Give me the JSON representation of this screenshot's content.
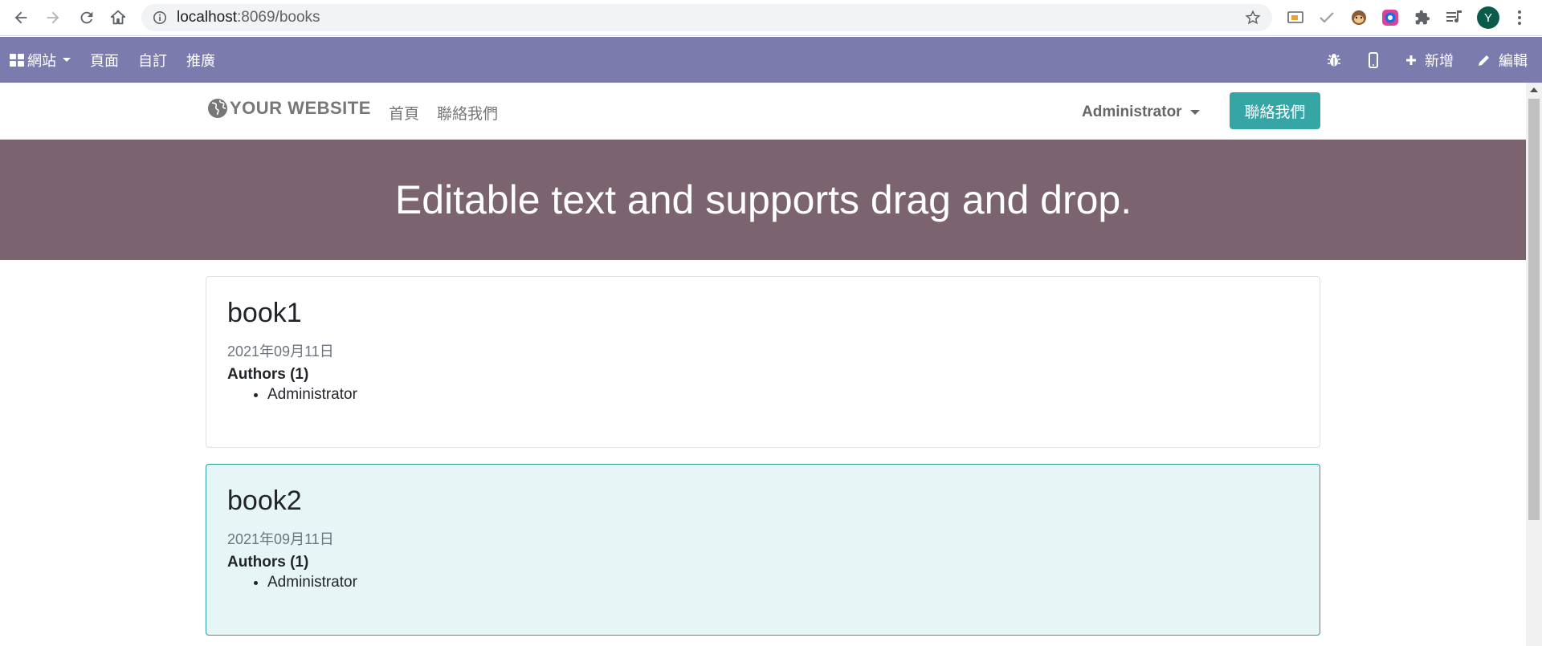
{
  "browser": {
    "url_host": "localhost",
    "url_path": ":8069/books",
    "profile_initial": "Y"
  },
  "adminbar": {
    "apps_label": "網站",
    "pages_label": "頁面",
    "customize_label": "自訂",
    "promote_label": "推廣",
    "new_label": "新增",
    "edit_label": "編輯"
  },
  "header": {
    "logo_text": "YOUR WEBSITE",
    "nav": [
      "首頁",
      "聯絡我們"
    ],
    "user": "Administrator",
    "contact_button": "聯絡我們"
  },
  "banner": {
    "text": "Editable text and supports drag and drop."
  },
  "books": [
    {
      "title": "book1",
      "date": "2021年09月11日",
      "authors_label": "Authors (1)",
      "authors": [
        "Administrator"
      ]
    },
    {
      "title": "book2",
      "date": "2021年09月11日",
      "authors_label": "Authors (1)",
      "authors": [
        "Administrator"
      ]
    }
  ],
  "colors": {
    "adminbar": "#7c7bad",
    "banner": "#7b6470",
    "primary": "#35a5a5",
    "active_card_bg": "#e6f5f5"
  }
}
